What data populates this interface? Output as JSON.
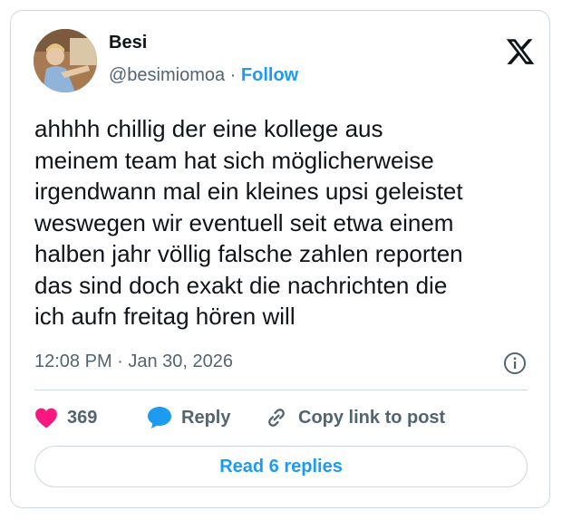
{
  "author": {
    "name": "Besi",
    "handle": "@besimiomoa",
    "separator": " · ",
    "follow_label": "Follow"
  },
  "post": {
    "text": "ahhhh chillig der eine kollege aus\nmeinem team hat sich möglicherweise\nirgendwann mal ein kleines upsi geleistet\nweswegen wir eventuell seit etwa einem\nhalben jahr völlig falsche zahlen reporten\ndas sind doch exakt die nachrichten die\nich aufn freitag hören will",
    "timestamp": "12:08 PM · Jan 30, 2026"
  },
  "actions": {
    "likes": "369",
    "reply_label": "Reply",
    "copy_label": "Copy link to post"
  },
  "read_replies_label": "Read 6 replies",
  "icons": {
    "brand": "x-logo-icon",
    "info": "info-icon",
    "like": "heart-icon",
    "reply": "speech-bubble-icon",
    "copy": "link-icon"
  },
  "colors": {
    "accent": "#1d9bf0",
    "like": "#f91880",
    "muted": "#536471"
  }
}
